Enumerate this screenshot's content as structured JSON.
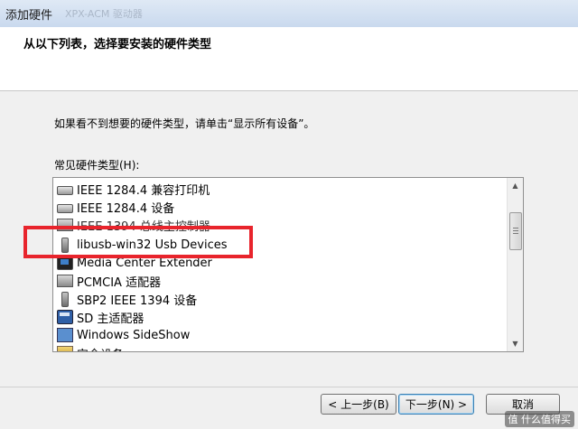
{
  "window": {
    "title": "添加硬件",
    "ghost_title": "XPX-ACM 驱动器"
  },
  "header": {
    "heading": "从以下列表，选择要安装的硬件类型"
  },
  "instruction": "如果看不到想要的硬件类型，请单击“显示所有设备”。",
  "list_caption": "常见硬件类型(H):",
  "list": {
    "items": [
      {
        "label": "IEEE 1284.4 兼容打印机",
        "icon": "printer-icon"
      },
      {
        "label": "IEEE 1284.4 设备",
        "icon": "printer-icon"
      },
      {
        "label": "IEEE 1394 总线主控制器",
        "icon": "card-icon"
      },
      {
        "label": "libusb-win32 Usb Devices",
        "icon": "usb-icon"
      },
      {
        "label": "Media Center Extender",
        "icon": "monitor-icon"
      },
      {
        "label": "PCMCIA 适配器",
        "icon": "card-icon"
      },
      {
        "label": "SBP2 IEEE 1394 设备",
        "icon": "usb-icon"
      },
      {
        "label": "SD 主适配器",
        "icon": "sd-icon"
      },
      {
        "label": "Windows SideShow",
        "icon": "sideshow-icon"
      },
      {
        "label": "安全设备",
        "icon": "generic-icon"
      }
    ],
    "highlighted": "libusb-win32 Usb Devices",
    "highlight_color": "#e8242c"
  },
  "buttons": {
    "back": "< 上一步(B)",
    "next": "下一步(N) >",
    "cancel": "取消"
  },
  "watermark": "值 什么值得买"
}
